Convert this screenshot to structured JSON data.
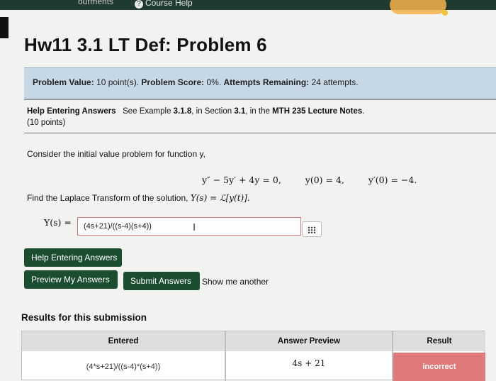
{
  "nav": {
    "left_link": "ourments",
    "course_help": "Course Help"
  },
  "title": "Hw11 3.1 LT Def: Problem 6",
  "info": {
    "value_label": "Problem Value:",
    "value_text": "10 point(s).",
    "score_label": "Problem Score:",
    "score_text": "0%.",
    "attempts_label": "Attempts Remaining:",
    "attempts_text": "24 attempts."
  },
  "help_note": {
    "label": "Help Entering Answers",
    "pre": "See Example",
    "example": "3.1.8",
    "mid": ", in Section",
    "section": "3.1",
    "mid2": ", in the",
    "notes": "MTH 235 Lecture Notes",
    "end": ".",
    "points": "(10 points)"
  },
  "problem": {
    "statement": "Consider the initial value problem for function y,",
    "equation": "y″ − 5y′ + 4y = 0,",
    "ic1": "y(0) = 4,",
    "ic2": "y′(0) = −4.",
    "find_text": "Find the Laplace Transform of the solution,",
    "find_expr": "Y(s) = ℒ[y(t)].",
    "answer_label": "Y(s) =",
    "answer_value": "(4s+21)/((s-4)(s+4))"
  },
  "buttons": {
    "help": "Help Entering Answers",
    "preview": "Preview My Answers",
    "submit": "Submit Answers",
    "show_another": "Show me another"
  },
  "results": {
    "title": "Results for this submission",
    "headers": [
      "Entered",
      "Answer Preview",
      "Result"
    ],
    "row": {
      "entered": "(4*s+21)/((s-4)*(s+4))",
      "preview": "4s + 21",
      "result": "incorrect"
    }
  },
  "colors": {
    "nav": "#1f3a30",
    "button": "#1b4e2f",
    "info_bg": "#c6d7e6",
    "incorrect": "#e07a7a"
  }
}
